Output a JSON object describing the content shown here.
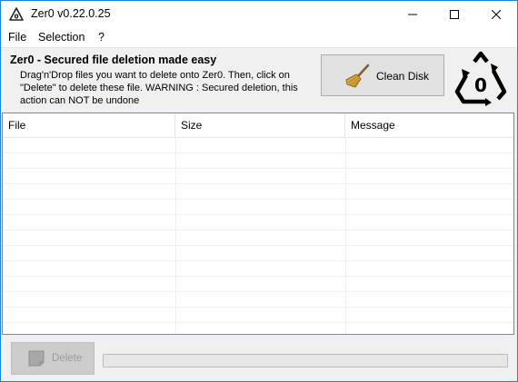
{
  "window": {
    "title": "Zer0 v0.22.0.25",
    "app_icon": "recycle-zero-icon",
    "controls": [
      "minimize-icon",
      "maximize-icon",
      "close-icon"
    ]
  },
  "menu": {
    "items": [
      {
        "label": "File"
      },
      {
        "label": "Selection"
      },
      {
        "label": "?"
      }
    ]
  },
  "header": {
    "title": "Zer0 - Secured file deletion made easy",
    "description": "Drag'n'Drop files you want to delete onto Zer0. Then, click on \"Delete\" to delete these file. WARNING : Secured deletion, this action can NOT be undone",
    "clean_disk_label": "Clean Disk",
    "clean_disk_icon": "broom-icon",
    "logo_icon": "recycle-zero-logo",
    "logo_text": "0"
  },
  "list": {
    "columns": [
      {
        "label": "File"
      },
      {
        "label": "Size"
      },
      {
        "label": "Message"
      }
    ],
    "rows": []
  },
  "footer": {
    "delete_label": "Delete",
    "delete_icon": "trash-icon",
    "delete_enabled": false,
    "progress": 0
  }
}
